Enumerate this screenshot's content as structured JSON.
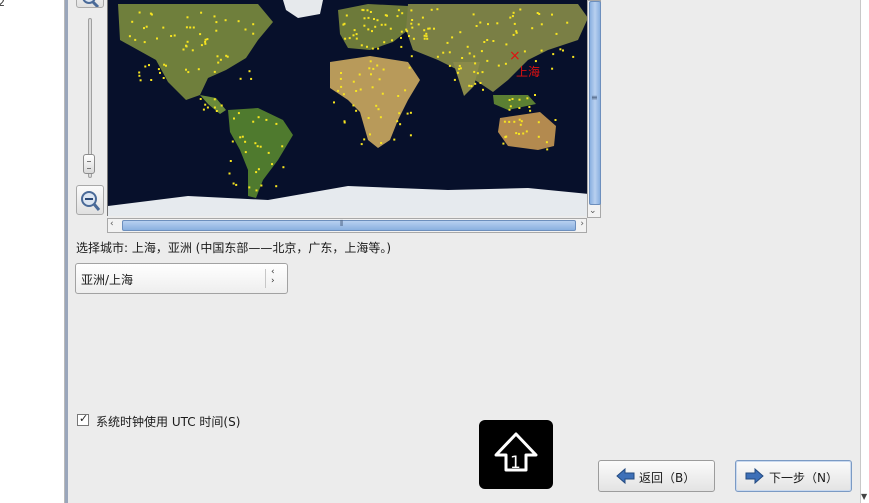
{
  "left_pane": {
    "text": "2"
  },
  "map": {
    "marker_city": "上海",
    "ocean_color": "#07102b",
    "land_color": "#6a7a3a",
    "dot_color": "#f7e520",
    "marker_color": "#e01010"
  },
  "timezone": {
    "city_label": "选择城市: 上海，亚洲 (中国东部——北京，广东，上海等。)",
    "selected": "亚洲/上海"
  },
  "utc": {
    "label": "系统时钟使用 UTC 时间(S)",
    "checked": true
  },
  "buttons": {
    "back": "返回（B）",
    "next": "下一步（N）"
  },
  "icons": [
    "zoom-in-icon",
    "zoom-out-icon",
    "back-arrow-icon",
    "next-arrow-icon",
    "keyboard-shift-icon"
  ]
}
